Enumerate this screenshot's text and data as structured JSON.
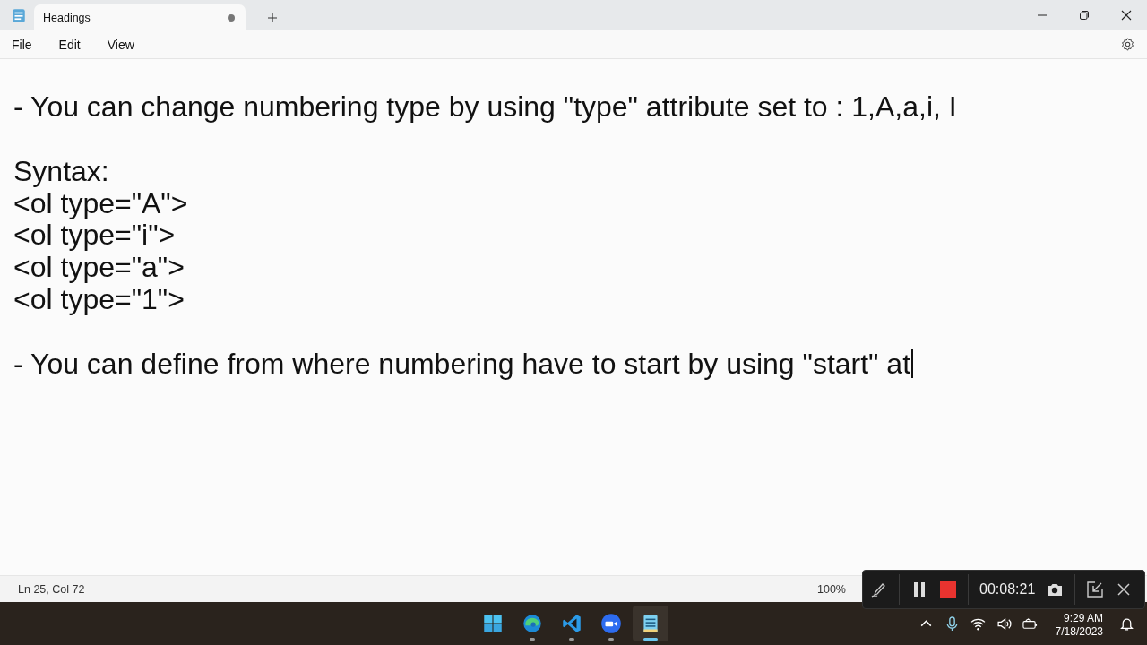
{
  "window": {
    "tabs": [
      {
        "label": "Headings",
        "selected": true,
        "unsaved": true
      }
    ]
  },
  "menu": [
    "File",
    "Edit",
    "View"
  ],
  "editor": {
    "lines": [
      {
        "kind": "blank"
      },
      {
        "kind": "text",
        "text": "- You can change numbering type by using \"type\" attribute set to : 1,A,a,i, I"
      },
      {
        "kind": "blank"
      },
      {
        "kind": "text",
        "text": "Syntax:"
      },
      {
        "kind": "text",
        "text": "<ol type=\"A\">"
      },
      {
        "kind": "text",
        "text": "<ol type=\"i\">"
      },
      {
        "kind": "text",
        "text": "<ol type=\"a\">"
      },
      {
        "kind": "text",
        "text": "<ol type=\"1\">"
      },
      {
        "kind": "blank"
      },
      {
        "kind": "text",
        "text": "- You can define from where numbering have to start by using \"start\" at",
        "cursor": true
      }
    ]
  },
  "status_bar": {
    "position": "Ln 25, Col 72",
    "zoom": "100%"
  },
  "recorder": {
    "timer": "00:08:21"
  },
  "taskbar": {
    "apps": [
      {
        "kind": "start"
      },
      {
        "kind": "edge",
        "running": true
      },
      {
        "kind": "vscode",
        "running": true
      },
      {
        "kind": "zoom",
        "running": true
      },
      {
        "kind": "notepad",
        "running": true,
        "selected": true
      }
    ],
    "time": "9:29 AM",
    "date": "7/18/2023"
  }
}
